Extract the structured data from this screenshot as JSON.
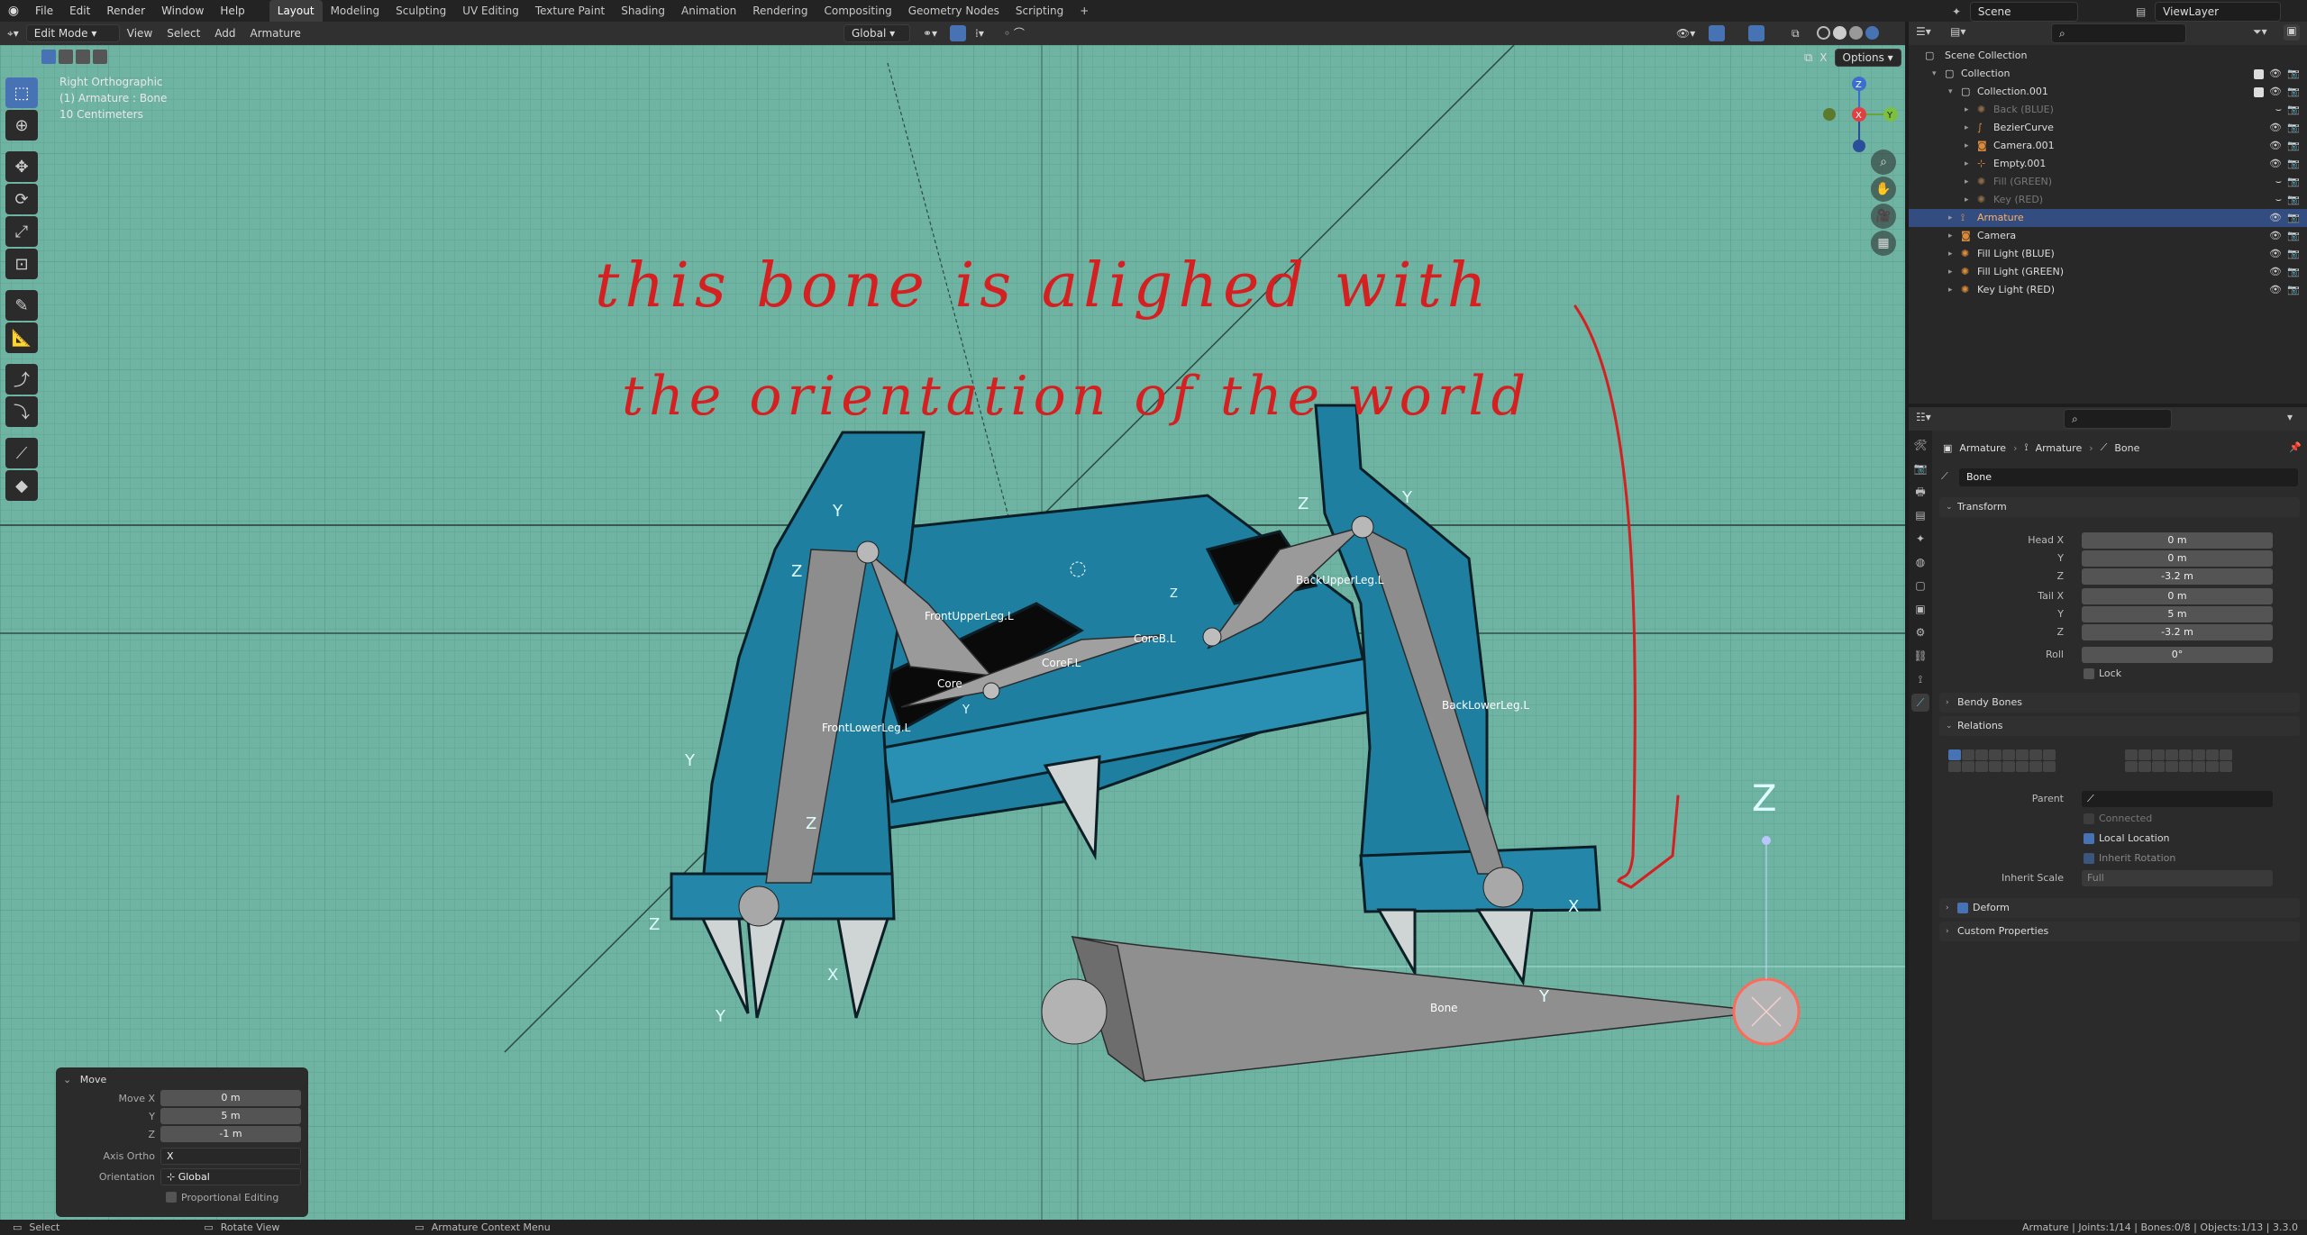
{
  "topbar": {
    "menus": [
      "File",
      "Edit",
      "Render",
      "Window",
      "Help"
    ],
    "workspaces": [
      "Layout",
      "Modeling",
      "Sculpting",
      "UV Editing",
      "Texture Paint",
      "Shading",
      "Animation",
      "Rendering",
      "Compositing",
      "Geometry Nodes",
      "Scripting"
    ],
    "active_workspace": "Layout",
    "add_tab": "+",
    "scene": "Scene",
    "view_layer": "ViewLayer"
  },
  "viewport_header": {
    "mode": "Edit Mode",
    "menus": [
      "View",
      "Select",
      "Add",
      "Armature"
    ],
    "orientation": "Global",
    "options": "Options",
    "x_label": "X"
  },
  "viewport": {
    "view_name": "Right Orthographic",
    "object_info": "(1) Armature : Bone",
    "scale_info": "10 Centimeters",
    "handwriting_line1": "this bone is alighed with",
    "handwriting_line2": "the orientation of the world",
    "bone_labels": [
      "FrontUpperLeg.L",
      "BackUpperLeg.L",
      "Core",
      "CoreF.L",
      "CoreB.L",
      "FrontLowerLeg.L",
      "BackLowerLeg.L",
      "Bone"
    ],
    "axis_letters": {
      "y": "Y",
      "z": "Z",
      "x": "X"
    }
  },
  "move_panel": {
    "title": "Move",
    "move_x_label": "Move X",
    "move_x": "0 m",
    "y_label": "Y",
    "y": "5 m",
    "z_label": "Z",
    "z": "-1 m",
    "axis_ortho_label": "Axis Ortho",
    "axis_ortho": "X",
    "orientation_label": "Orientation",
    "orientation": "Global",
    "proportional": "Proportional Editing"
  },
  "statusbar": {
    "select": "Select",
    "rotate": "Rotate View",
    "context": "Armature Context Menu",
    "stats": "Armature | Joints:1/14 | Bones:0/8 | Objects:1/13 | 3.3.0"
  },
  "outliner": {
    "root": "Scene Collection",
    "items": [
      {
        "label": "Collection",
        "depth": 1,
        "dim": false,
        "icon": "collection-icon",
        "color": "#dddddd"
      },
      {
        "label": "Collection.001",
        "depth": 2,
        "dim": false,
        "icon": "collection-icon",
        "color": "#dddddd"
      },
      {
        "label": "Back (BLUE)",
        "depth": 3,
        "dim": true,
        "icon": "light-icon",
        "color": "#d98a3a"
      },
      {
        "label": "BezierCurve",
        "depth": 3,
        "dim": false,
        "icon": "curve-icon",
        "color": "#d98a3a"
      },
      {
        "label": "Camera.001",
        "depth": 3,
        "dim": false,
        "icon": "camera-icon",
        "color": "#d98a3a"
      },
      {
        "label": "Empty.001",
        "depth": 3,
        "dim": false,
        "icon": "empty-icon",
        "color": "#d98a3a"
      },
      {
        "label": "Fill (GREEN)",
        "depth": 3,
        "dim": true,
        "icon": "light-icon",
        "color": "#d98a3a"
      },
      {
        "label": "Key (RED)",
        "depth": 3,
        "dim": true,
        "icon": "light-icon",
        "color": "#d98a3a"
      },
      {
        "label": "Armature",
        "depth": 2,
        "dim": false,
        "icon": "armature-icon",
        "color": "#e8a04a",
        "selected": true
      },
      {
        "label": "Camera",
        "depth": 2,
        "dim": false,
        "icon": "camera-icon",
        "color": "#d98a3a"
      },
      {
        "label": "Fill Light (BLUE)",
        "depth": 2,
        "dim": false,
        "icon": "light-icon",
        "color": "#d98a3a"
      },
      {
        "label": "Fill Light (GREEN)",
        "depth": 2,
        "dim": false,
        "icon": "light-icon",
        "color": "#d98a3a"
      },
      {
        "label": "Key Light (RED)",
        "depth": 2,
        "dim": false,
        "icon": "light-icon",
        "color": "#d98a3a"
      }
    ]
  },
  "properties": {
    "breadcrumb": [
      "Armature",
      "Armature",
      "Bone"
    ],
    "bone_name": "Bone",
    "transform_title": "Transform",
    "head_x_label": "Head X",
    "head_x": "0 m",
    "head_y_label": "Y",
    "head_y": "0 m",
    "head_z_label": "Z",
    "head_z": "-3.2 m",
    "tail_x_label": "Tail X",
    "tail_x": "0 m",
    "tail_y_label": "Y",
    "tail_y": "5 m",
    "tail_z_label": "Z",
    "tail_z": "-3.2 m",
    "roll_label": "Roll",
    "roll": "0°",
    "lock": "Lock",
    "bendy_bones": "Bendy Bones",
    "relations": "Relations",
    "parent_label": "Parent",
    "connected": "Connected",
    "local_location": "Local Location",
    "inherit_rotation": "Inherit Rotation",
    "inherit_scale_label": "Inherit Scale",
    "inherit_scale": "Full",
    "deform": "Deform",
    "custom_properties": "Custom Properties"
  },
  "colors": {
    "viewport_bg": "#6fb3a3",
    "accent": "#4772b3",
    "handwriting": "#d42020",
    "creature": "#1e7fa0"
  }
}
